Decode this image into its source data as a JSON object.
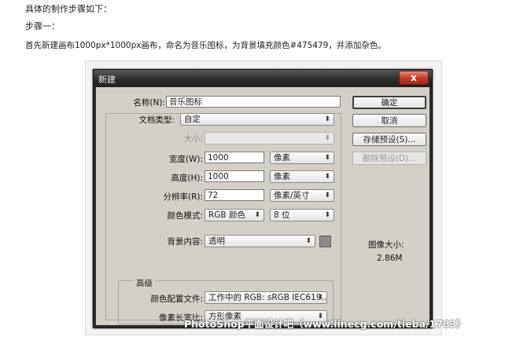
{
  "article": {
    "line1": "具体的制作步骤如下：",
    "line2": "步骤一：",
    "line3": "首先新建画布1000px*1000px画布，命名为音乐图标，为背景填充颜色#475479，并添加杂色。"
  },
  "dialog": {
    "title": "新建",
    "close_glyph": "x",
    "name_label": "名称(N):",
    "name_value": "音乐图标",
    "preset_label": "文档类型:",
    "preset_value": "自定",
    "size_label": "大小:",
    "size_value": "",
    "width_label": "宽度(W):",
    "width_value": "1000",
    "width_unit": "像素",
    "height_label": "高度(H):",
    "height_value": "1000",
    "height_unit": "像素",
    "resolution_label": "分辨率(R):",
    "resolution_value": "72",
    "resolution_unit": "像素/英寸",
    "color_mode_label": "颜色模式:",
    "color_mode_value": "RGB 颜色",
    "bit_depth_value": "8 位",
    "background_label": "背景内容:",
    "background_value": "透明",
    "advanced_label": "高级",
    "color_profile_label": "颜色配置文件:",
    "color_profile_value": "工作中的 RGB: sRGB IEC619...",
    "pixel_aspect_label": "像素长宽比:",
    "pixel_aspect_value": "方形像素",
    "image_size_label": "图像大小:",
    "image_size_value": "2.86M",
    "buttons": {
      "ok": "确定",
      "cancel": "取消",
      "save_preset": "存储预设(S)...",
      "delete_preset": "删除预设(D)..."
    }
  },
  "watermark": "PhotoShop平面设计吧（www.linecg.com/tieba/1783）",
  "colors": {
    "titlebar": "#2a2a2a",
    "client": "#d4d0c8",
    "close": "#c2392a"
  }
}
